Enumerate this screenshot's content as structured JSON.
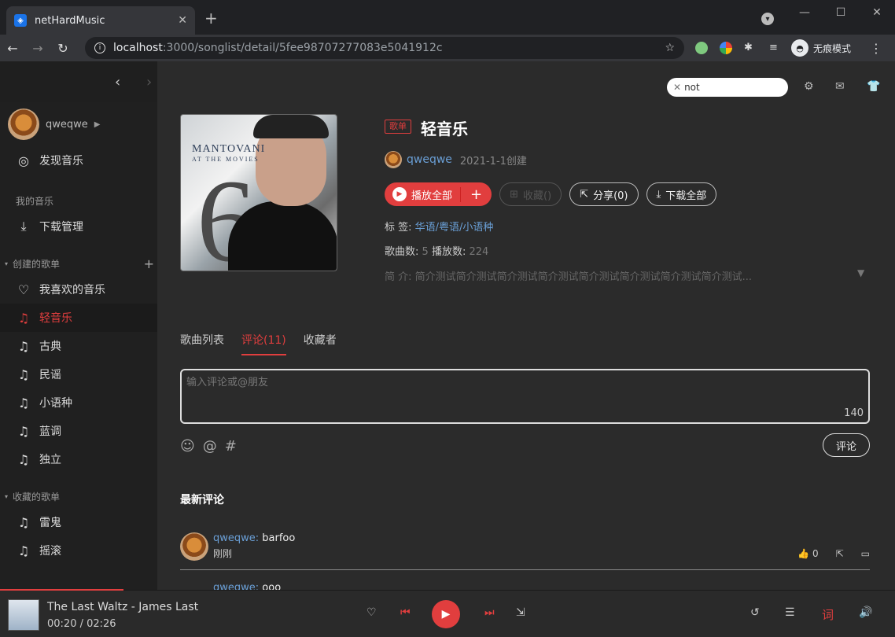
{
  "browser": {
    "tab_title": "netHardMusic",
    "tab_close": "✕",
    "new_tab": "+",
    "url_host": "localhost",
    "url_path": ":3000/songlist/detail/5fee98707277083e5041912c",
    "incognito_label": "无痕模式"
  },
  "sidebar": {
    "user_name": "qweqwe",
    "discover": "发现音乐",
    "my_music_header": "我的音乐",
    "download_mgr": "下载管理",
    "created_header": "创建的歌单",
    "created": [
      "我喜欢的音乐",
      "轻音乐",
      "古典",
      "民谣",
      "小语种",
      "蓝调",
      "独立"
    ],
    "collected_header": "收藏的歌单",
    "collected": [
      "雷鬼",
      "摇滚"
    ]
  },
  "topbar": {
    "search_value": "not"
  },
  "playlist": {
    "badge": "歌单",
    "title": "轻音乐",
    "creator": "qweqwe",
    "created_date": "2021-1-1创建",
    "cover_text": "MANTOVANI",
    "cover_sub": "AT THE MOVIES",
    "play_all": "播放全部",
    "collect": "收藏()",
    "share": "分享(0)",
    "download_all": "下载全部",
    "tags_label": "标  签:",
    "tags": "华语/粤语/小语种",
    "song_count_label": "歌曲数:",
    "song_count": "5",
    "play_count_label": "播放数:",
    "play_count": "224",
    "desc_label": "简  介:",
    "desc": "简介测试简介测试简介测试简介测试简介测试简介测试简介测试简介测试..."
  },
  "tabs": [
    "歌曲列表",
    "评论(11)",
    "收藏者"
  ],
  "comment_box": {
    "placeholder": "输入评论或@朋友",
    "remaining": "140",
    "submit": "评论"
  },
  "latest_title": "最新评论",
  "comments": [
    {
      "user": "qweqwe:",
      "text": "barfoo",
      "time": "刚刚",
      "likes": "0"
    },
    {
      "user": "qweqwe:",
      "text": "ooo",
      "time": "",
      "likes": ""
    }
  ],
  "player": {
    "song": "The Last Waltz - James Last",
    "time": "00:20 / 02:26",
    "progress": 0.138,
    "lyric_btn": "词"
  }
}
